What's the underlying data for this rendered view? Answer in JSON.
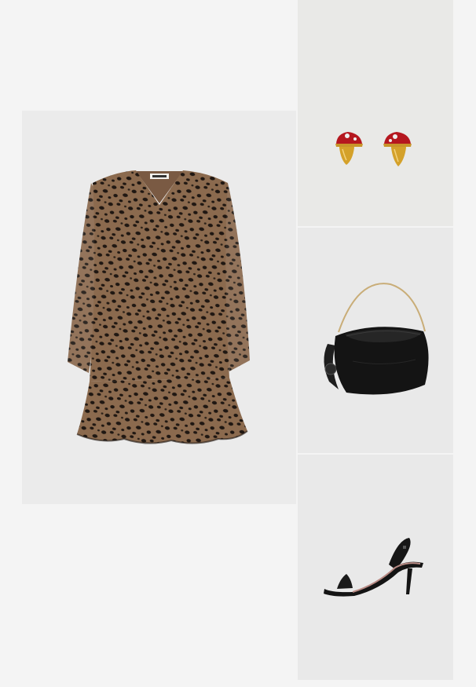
{
  "products": [
    {
      "id": "dress",
      "alt": "",
      "icon": "leopard-print-dress-image"
    },
    {
      "id": "earrings",
      "alt": "",
      "icon": "mushroom-earrings-image"
    },
    {
      "id": "bag",
      "alt": "",
      "icon": "black-shoulder-bag-image"
    },
    {
      "id": "sandals",
      "alt": "",
      "icon": "black-heeled-sandal-image"
    }
  ],
  "colors": {
    "page_background": "#f4f4f4",
    "tile_background": "#ebebeb",
    "leopard_base": "#8b6a4e",
    "leopard_spot": "#1f1712",
    "earring_cap": "#b5171f",
    "earring_gold": "#d4a12a",
    "bag_black": "#141414",
    "bag_handle": "#c9ad78"
  }
}
